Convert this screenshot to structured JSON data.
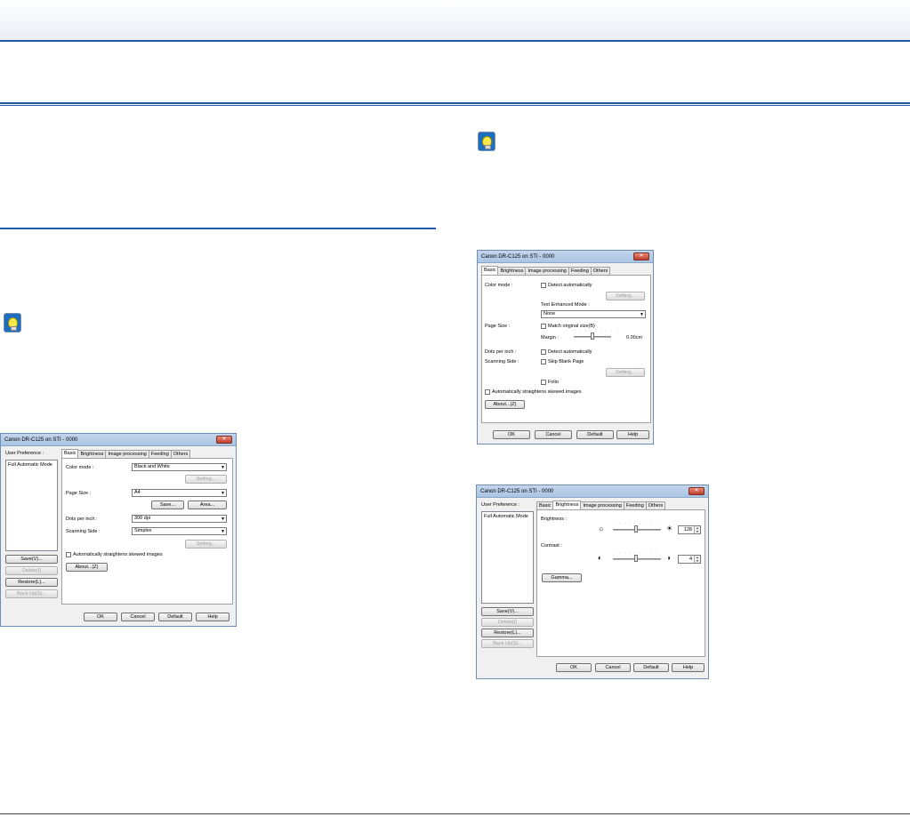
{
  "dialog_title": "Canon DR-C125 on STI - 0000",
  "tabs": [
    "Basic",
    "Brightness",
    "Image processing",
    "Feeding",
    "Others"
  ],
  "user_preference": {
    "label": "User Preference :",
    "items": [
      "Full Automatic Mode"
    ],
    "buttons": {
      "save": "Save(V)...",
      "delete": "Delete(I)",
      "restore": "Restore(L)...",
      "backup": "Back Up(S)..."
    }
  },
  "footer": {
    "ok": "OK",
    "cancel": "Cancel",
    "default": "Default",
    "help": "Help"
  },
  "dialog1": {
    "color_mode_label": "Color mode :",
    "color_mode_value": "Black and White",
    "setting": "Setting...",
    "page_size_label": "Page Size :",
    "page_size_value": "A4",
    "save": "Save...",
    "area": "Area...",
    "dpi_label": "Dots per inch :",
    "dpi_value": "300 dpi",
    "side_label": "Scanning Side :",
    "side_value": "Simplex",
    "straighten": "Automatically straightens skewed images",
    "about": "About...(Z)"
  },
  "dialog2": {
    "color_mode_label": "Color mode :",
    "detect_auto": "Detect automatically",
    "setting": "Setting...",
    "text_enhanced_label": "Text Enhanced Mode :",
    "text_enhanced_value": "None",
    "page_size_label": "Page Size :",
    "match_original": "Match original size(B)",
    "margin_label": "Margin :",
    "margin_value": "0.00cm",
    "dpi_label": "Dots per inch :",
    "dpi_detect": "Detect automatically",
    "side_label": "Scanning Side :",
    "skip_blank": "Skip Blank Page",
    "folio": "Folio",
    "straighten": "Automatically straightens skewed images",
    "about": "About...(Z)"
  },
  "dialog3": {
    "brightness_label": "Brightness :",
    "brightness_value": "128",
    "contrast_label": "Contrast :",
    "contrast_value": "4",
    "gamma": "Gamma..."
  }
}
